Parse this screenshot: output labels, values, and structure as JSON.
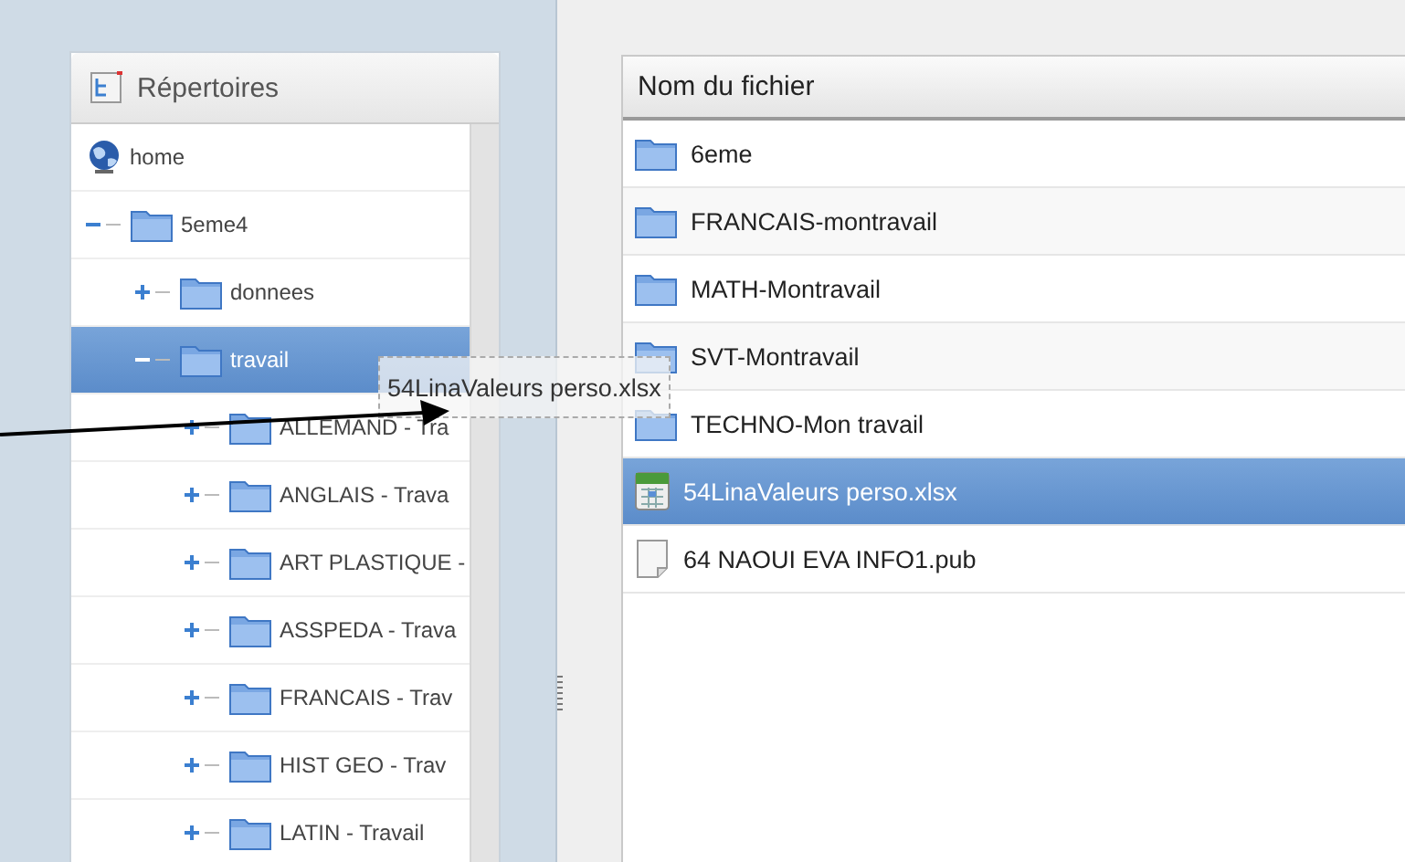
{
  "directory_panel": {
    "title": "Répertoires",
    "tree": [
      {
        "label": "home",
        "kind": "root",
        "selected": false,
        "children": [
          {
            "label": "5eme4",
            "kind": "folder",
            "selected": false,
            "expanded": true,
            "children": [
              {
                "label": "donnees",
                "kind": "folder",
                "selected": false,
                "expanded": false
              },
              {
                "label": "travail",
                "kind": "folder",
                "selected": true,
                "expanded": true,
                "children": [
                  {
                    "label": "ALLEMAND - Tra",
                    "kind": "folder",
                    "selected": false,
                    "expanded": false
                  },
                  {
                    "label": "ANGLAIS - Trava",
                    "kind": "folder",
                    "selected": false,
                    "expanded": false
                  },
                  {
                    "label": "ART PLASTIQUE -",
                    "kind": "folder",
                    "selected": false,
                    "expanded": false
                  },
                  {
                    "label": "ASSPEDA - Trava",
                    "kind": "folder",
                    "selected": false,
                    "expanded": false
                  },
                  {
                    "label": "FRANCAIS - Trav",
                    "kind": "folder",
                    "selected": false,
                    "expanded": false
                  },
                  {
                    "label": "HIST GEO - Trav",
                    "kind": "folder",
                    "selected": false,
                    "expanded": false
                  },
                  {
                    "label": "LATIN - Travail",
                    "kind": "folder",
                    "selected": false,
                    "expanded": false
                  }
                ]
              }
            ]
          }
        ]
      }
    ]
  },
  "file_list": {
    "column": "Nom du fichier",
    "rows": [
      {
        "name": "6eme",
        "kind": "folder",
        "selected": false
      },
      {
        "name": "FRANCAIS-montravail",
        "kind": "folder",
        "selected": false
      },
      {
        "name": "MATH-Montravail",
        "kind": "folder",
        "selected": false
      },
      {
        "name": "SVT-Montravail",
        "kind": "folder",
        "selected": false
      },
      {
        "name": "TECHNO-Mon travail",
        "kind": "folder",
        "selected": false
      },
      {
        "name": "54LinaValeurs perso.xlsx",
        "kind": "spreadsheet",
        "selected": true
      },
      {
        "name": "64 NAOUI EVA INFO1.pub",
        "kind": "document",
        "selected": false
      }
    ]
  },
  "drag_ghost": {
    "label": "54LinaValeurs perso.xlsx"
  }
}
